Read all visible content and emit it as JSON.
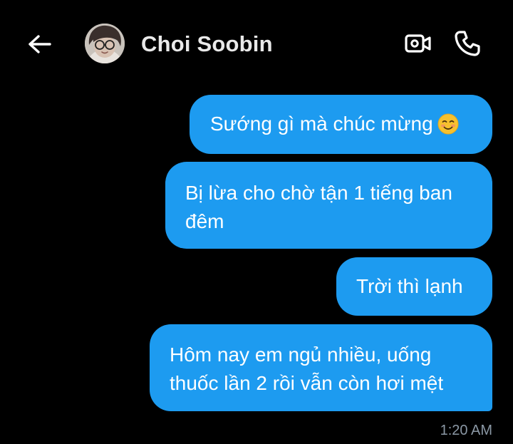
{
  "header": {
    "contact_name": "Choi Soobin",
    "icons": {
      "back": "arrow-left-icon",
      "video": "video-camera-icon",
      "call": "phone-icon"
    }
  },
  "colors": {
    "background": "#000000",
    "bubble": "#1d9bf0",
    "timestamp": "#8b98a5"
  },
  "messages": [
    {
      "text": "Sướng gì mà chúc mừng",
      "emoji": "smiling-face-icon"
    },
    {
      "line1": "Bị lừa cho chờ tận 1 tiếng ban",
      "line2": "đêm"
    },
    {
      "text": "Trời thì lạnh"
    },
    {
      "line1": "Hôm nay em ngủ nhiều, uống",
      "line2": "thuốc lần 2 rồi vẫn còn hơi mệt"
    }
  ],
  "timestamp": "1:20 AM"
}
